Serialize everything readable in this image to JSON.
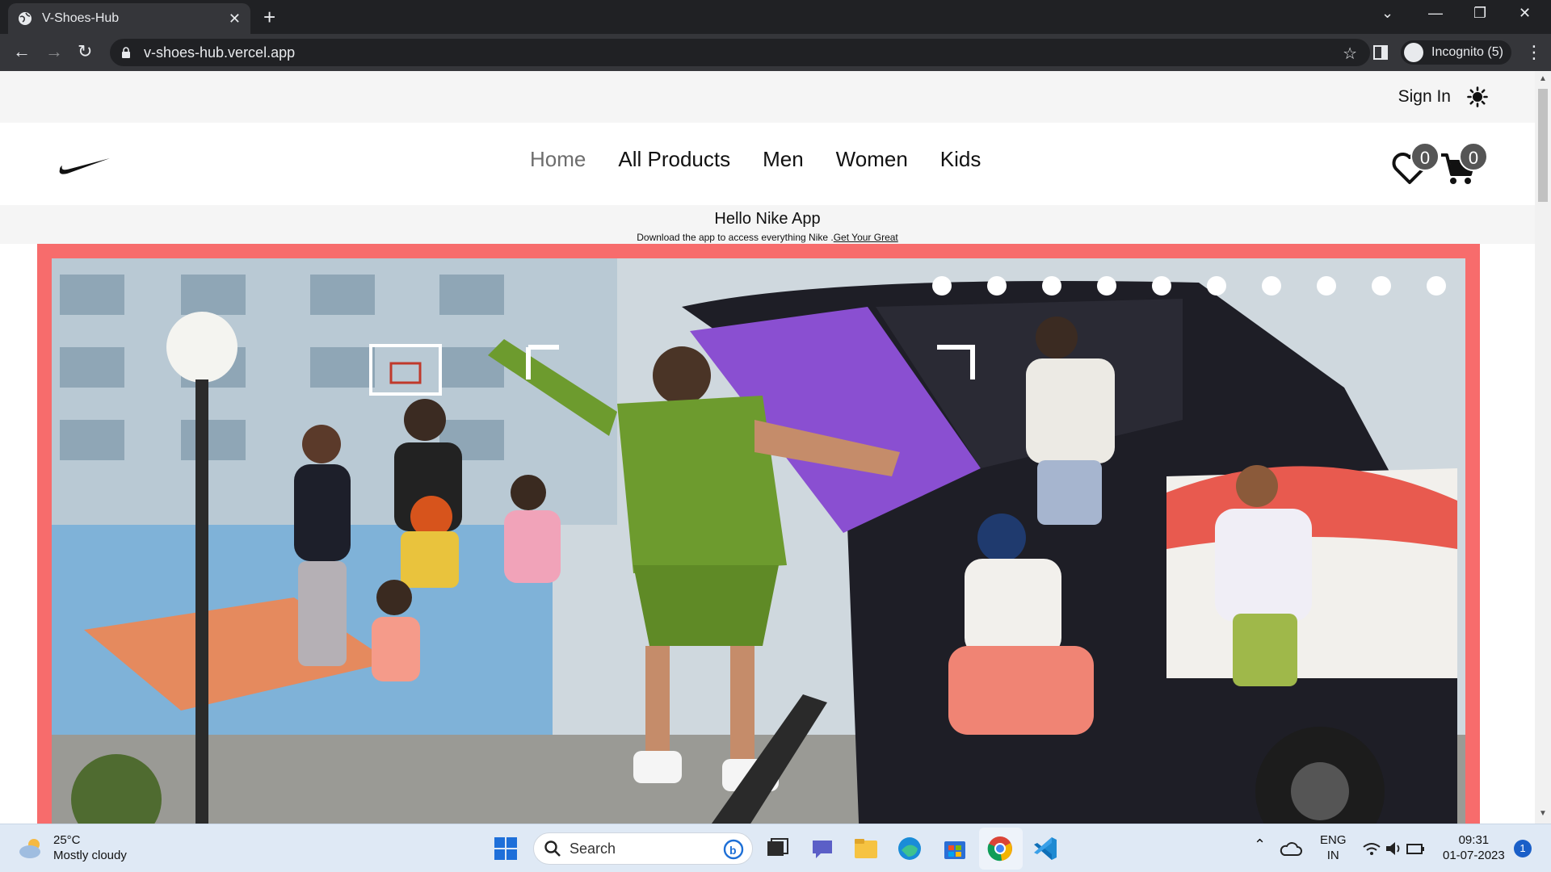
{
  "browser": {
    "tab_title": "V-Shoes-Hub",
    "url": "v-shoes-hub.vercel.app",
    "incognito_label": "Incognito (5)"
  },
  "site": {
    "top_bar": {
      "sign_in": "Sign In"
    },
    "nav": {
      "items": [
        {
          "label": "Home",
          "active": true
        },
        {
          "label": "All Products"
        },
        {
          "label": "Men"
        },
        {
          "label": "Women"
        },
        {
          "label": "Kids"
        }
      ],
      "wishlist_count": "0",
      "cart_count": "0"
    },
    "promo": {
      "title": "Hello Nike App",
      "text": "Download the app to access everything Nike .",
      "link": "Get Your Great"
    },
    "hero": {
      "slide_count": 10,
      "frame_color": "#f76c6c"
    }
  },
  "taskbar": {
    "weather_temp": "25°C",
    "weather_desc": "Mostly cloudy",
    "search_label": "Search",
    "lang_1": "ENG",
    "lang_2": "IN",
    "time": "09:31",
    "date": "01-07-2023",
    "notifications": "1"
  }
}
